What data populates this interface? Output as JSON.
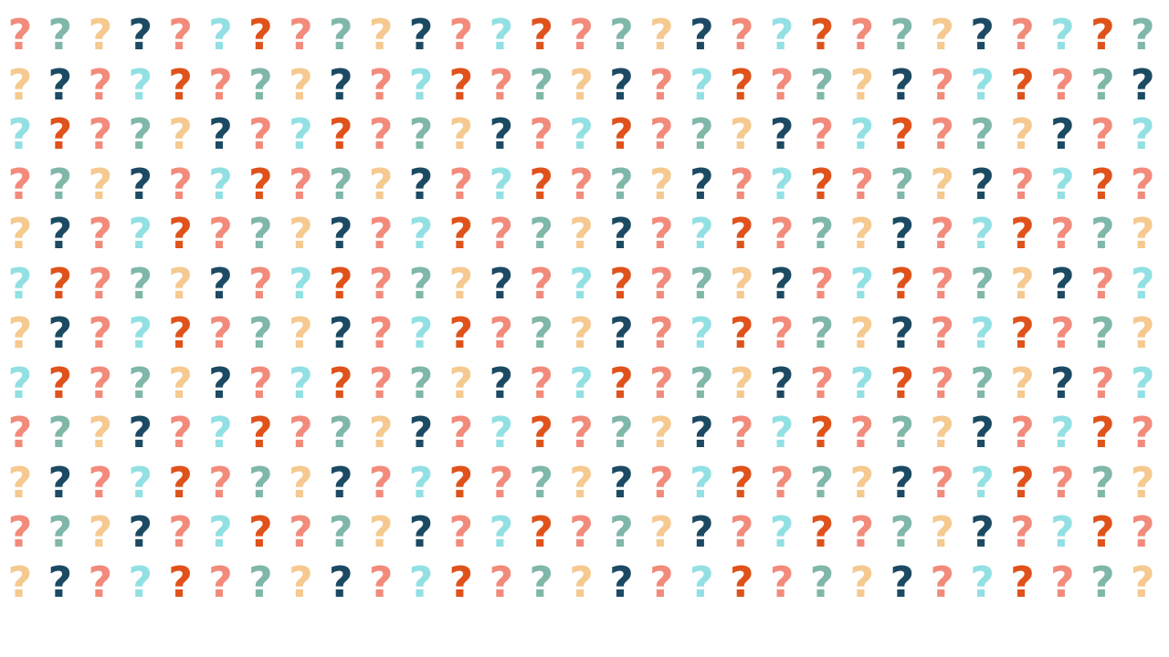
{
  "pattern": {
    "glyph": "?",
    "rows": 12,
    "columns": 29,
    "palette": {
      "salmon": "#f28b7b",
      "teal": "#7fb7a9",
      "peach": "#f5c98f",
      "navy": "#1c4a63",
      "cyan": "#92e0e3",
      "orange": "#e0521b"
    },
    "row_colors": [
      [
        "salmon",
        "teal",
        "peach",
        "navy",
        "salmon",
        "cyan",
        "orange",
        "salmon",
        "teal",
        "peach",
        "navy",
        "salmon",
        "cyan",
        "orange",
        "salmon",
        "teal",
        "peach",
        "navy",
        "salmon",
        "cyan",
        "orange",
        "salmon",
        "teal",
        "peach",
        "navy",
        "salmon",
        "cyan",
        "orange",
        "teal"
      ],
      [
        "peach",
        "navy",
        "salmon",
        "cyan",
        "orange",
        "salmon",
        "teal",
        "peach",
        "navy",
        "salmon",
        "cyan",
        "orange",
        "salmon",
        "teal",
        "peach",
        "navy",
        "salmon",
        "cyan",
        "orange",
        "salmon",
        "teal",
        "peach",
        "navy",
        "salmon",
        "cyan",
        "orange",
        "salmon",
        "teal",
        "navy"
      ],
      [
        "cyan",
        "orange",
        "salmon",
        "teal",
        "peach",
        "navy",
        "salmon",
        "cyan",
        "orange",
        "salmon",
        "teal",
        "peach",
        "navy",
        "salmon",
        "cyan",
        "orange",
        "salmon",
        "teal",
        "peach",
        "navy",
        "salmon",
        "cyan",
        "orange",
        "salmon",
        "teal",
        "peach",
        "navy",
        "salmon",
        "cyan"
      ],
      [
        "salmon",
        "teal",
        "peach",
        "navy",
        "salmon",
        "cyan",
        "orange",
        "salmon",
        "teal",
        "peach",
        "navy",
        "salmon",
        "cyan",
        "orange",
        "salmon",
        "teal",
        "peach",
        "navy",
        "salmon",
        "cyan",
        "orange",
        "salmon",
        "teal",
        "peach",
        "navy",
        "salmon",
        "cyan",
        "orange",
        "salmon"
      ],
      [
        "peach",
        "navy",
        "salmon",
        "cyan",
        "orange",
        "salmon",
        "teal",
        "peach",
        "navy",
        "salmon",
        "cyan",
        "orange",
        "salmon",
        "teal",
        "peach",
        "navy",
        "salmon",
        "cyan",
        "orange",
        "salmon",
        "teal",
        "peach",
        "navy",
        "salmon",
        "cyan",
        "orange",
        "salmon",
        "teal",
        "peach"
      ],
      [
        "cyan",
        "orange",
        "salmon",
        "teal",
        "peach",
        "navy",
        "salmon",
        "cyan",
        "orange",
        "salmon",
        "teal",
        "peach",
        "navy",
        "salmon",
        "cyan",
        "orange",
        "salmon",
        "teal",
        "peach",
        "navy",
        "salmon",
        "cyan",
        "orange",
        "salmon",
        "teal",
        "peach",
        "navy",
        "salmon",
        "cyan"
      ],
      [
        "peach",
        "navy",
        "salmon",
        "cyan",
        "orange",
        "salmon",
        "teal",
        "peach",
        "navy",
        "salmon",
        "cyan",
        "orange",
        "salmon",
        "teal",
        "peach",
        "navy",
        "salmon",
        "cyan",
        "orange",
        "salmon",
        "teal",
        "peach",
        "navy",
        "salmon",
        "cyan",
        "orange",
        "salmon",
        "teal",
        "peach"
      ],
      [
        "cyan",
        "orange",
        "salmon",
        "teal",
        "peach",
        "navy",
        "salmon",
        "cyan",
        "orange",
        "salmon",
        "teal",
        "peach",
        "navy",
        "salmon",
        "cyan",
        "orange",
        "salmon",
        "teal",
        "peach",
        "navy",
        "salmon",
        "cyan",
        "orange",
        "salmon",
        "teal",
        "peach",
        "navy",
        "salmon",
        "cyan"
      ],
      [
        "salmon",
        "teal",
        "peach",
        "navy",
        "salmon",
        "cyan",
        "orange",
        "salmon",
        "teal",
        "peach",
        "navy",
        "salmon",
        "cyan",
        "orange",
        "salmon",
        "teal",
        "peach",
        "navy",
        "salmon",
        "cyan",
        "orange",
        "salmon",
        "teal",
        "peach",
        "navy",
        "salmon",
        "cyan",
        "orange",
        "salmon"
      ],
      [
        "peach",
        "navy",
        "salmon",
        "cyan",
        "orange",
        "salmon",
        "teal",
        "peach",
        "navy",
        "salmon",
        "cyan",
        "orange",
        "salmon",
        "teal",
        "peach",
        "navy",
        "salmon",
        "cyan",
        "orange",
        "salmon",
        "teal",
        "peach",
        "navy",
        "salmon",
        "cyan",
        "orange",
        "salmon",
        "teal",
        "peach"
      ],
      [
        "salmon",
        "teal",
        "peach",
        "navy",
        "salmon",
        "cyan",
        "orange",
        "salmon",
        "teal",
        "peach",
        "navy",
        "salmon",
        "cyan",
        "orange",
        "salmon",
        "teal",
        "peach",
        "navy",
        "salmon",
        "cyan",
        "orange",
        "salmon",
        "teal",
        "peach",
        "navy",
        "salmon",
        "cyan",
        "orange",
        "salmon"
      ],
      [
        "peach",
        "navy",
        "salmon",
        "cyan",
        "orange",
        "salmon",
        "teal",
        "peach",
        "navy",
        "salmon",
        "cyan",
        "orange",
        "salmon",
        "teal",
        "peach",
        "navy",
        "salmon",
        "cyan",
        "orange",
        "salmon",
        "teal",
        "peach",
        "navy",
        "salmon",
        "cyan",
        "orange",
        "salmon",
        "teal",
        "peach"
      ]
    ]
  }
}
